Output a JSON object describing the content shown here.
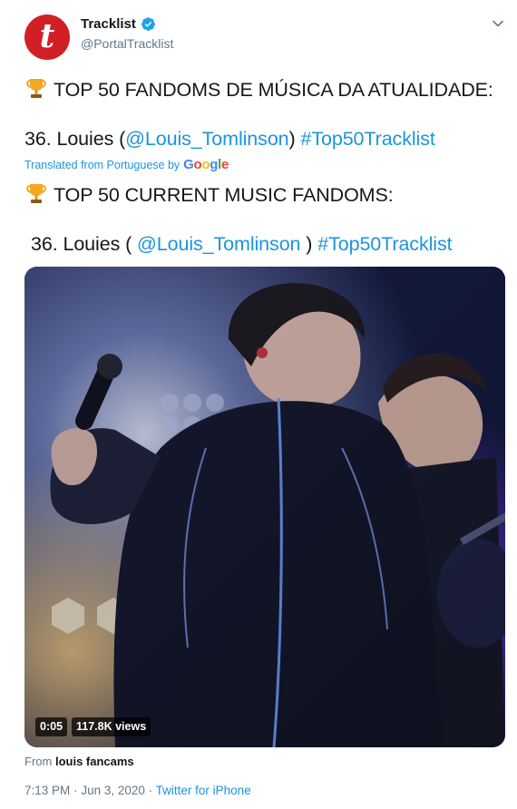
{
  "author": {
    "display_name": "Tracklist",
    "handle": "@PortalTracklist",
    "avatar_letter": "t",
    "avatar_color": "#d21f25",
    "verified_icon": "verified-badge-icon"
  },
  "original": {
    "line1": "TOP 50 FANDOMS DE MÚSICA DA ATUALIDADE:",
    "line2_prefix": "36. Louies (",
    "line2_mention": "@Louis_Tomlinson",
    "line2_mid": ")",
    "line2_hashtag": "#Top50Tracklist"
  },
  "translation": {
    "label": "Translated from Portuguese by",
    "provider": "Google"
  },
  "translated": {
    "line1": "TOP 50 CURRENT MUSIC FANDOMS:",
    "line2_prefix": "36. Louies (",
    "line2_mention": "@Louis_Tomlinson",
    "line2_mid": ")",
    "line2_hashtag": "#Top50Tracklist"
  },
  "media": {
    "duration": "0:05",
    "views": "117.8K views",
    "from_label": "From",
    "from_source": "louis fancams"
  },
  "meta": {
    "time": "7:13 PM",
    "separator": "·",
    "date": "Jun 3, 2020",
    "source": "Twitter for iPhone"
  },
  "colors": {
    "link": "#1b95e0",
    "secondary_text": "#657786",
    "primary_text": "#14171a"
  }
}
